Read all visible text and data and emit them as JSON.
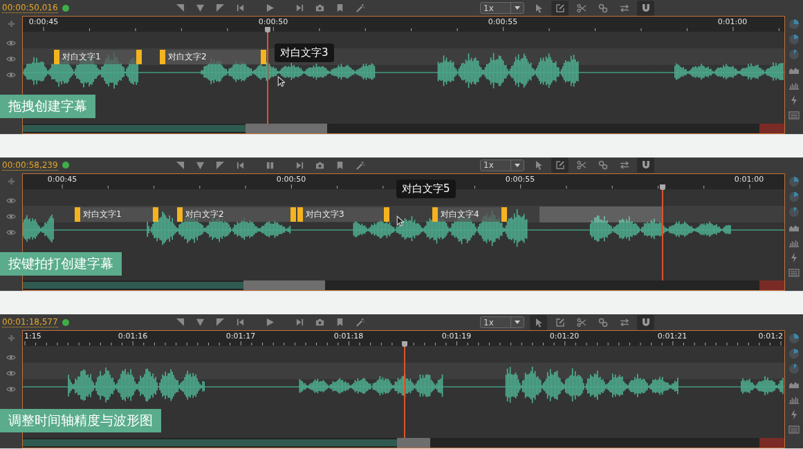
{
  "panels": [
    {
      "timecode": "00:00:50,016",
      "playing": false,
      "speed": "1x",
      "tools": [
        {
          "kind": "pointer",
          "selected": false
        },
        {
          "kind": "edit",
          "selected": true
        },
        {
          "kind": "scissors",
          "selected": false
        },
        {
          "kind": "link",
          "selected": false
        },
        {
          "kind": "swap",
          "selected": false
        },
        {
          "kind": "magnet",
          "selected": true
        }
      ],
      "ruler": [
        "0:00:45",
        "0:00:50",
        "0:00:55",
        "0:01:00"
      ],
      "subtitles": [
        {
          "text": "对白文字1"
        },
        {
          "text": "对白文字2"
        }
      ],
      "tooltip": "对白文字3",
      "caption": "拖拽创建字幕"
    },
    {
      "timecode": "00:00:58,239",
      "playing": true,
      "speed": "1x",
      "tools": [
        {
          "kind": "pointer",
          "selected": false
        },
        {
          "kind": "edit",
          "selected": true
        },
        {
          "kind": "scissors",
          "selected": false
        },
        {
          "kind": "link",
          "selected": false
        },
        {
          "kind": "swap",
          "selected": false
        },
        {
          "kind": "magnet",
          "selected": true
        }
      ],
      "ruler": [
        "0:00:45",
        "0:00:50",
        "0:00:55",
        "0:01:00"
      ],
      "subtitles": [
        {
          "text": "对白文字1"
        },
        {
          "text": "对白文字2"
        },
        {
          "text": "对白文字3"
        },
        {
          "text": "对白文字4"
        }
      ],
      "tooltip": "对白文字5",
      "caption": "按键拍打创建字幕"
    },
    {
      "timecode": "00:01:18,577",
      "playing": false,
      "speed": "1x",
      "tools": [
        {
          "kind": "pointer",
          "selected": true
        },
        {
          "kind": "edit",
          "selected": false
        },
        {
          "kind": "scissors",
          "selected": false
        },
        {
          "kind": "link",
          "selected": false
        },
        {
          "kind": "swap",
          "selected": false
        },
        {
          "kind": "magnet",
          "selected": true
        }
      ],
      "ruler": [
        "1:15",
        "0:01:16",
        "0:01:17",
        "0:01:18",
        "0:01:19",
        "0:01:20",
        "0:01:21",
        "0:01:2"
      ],
      "caption": "调整时间轴精度与波形图"
    }
  ]
}
